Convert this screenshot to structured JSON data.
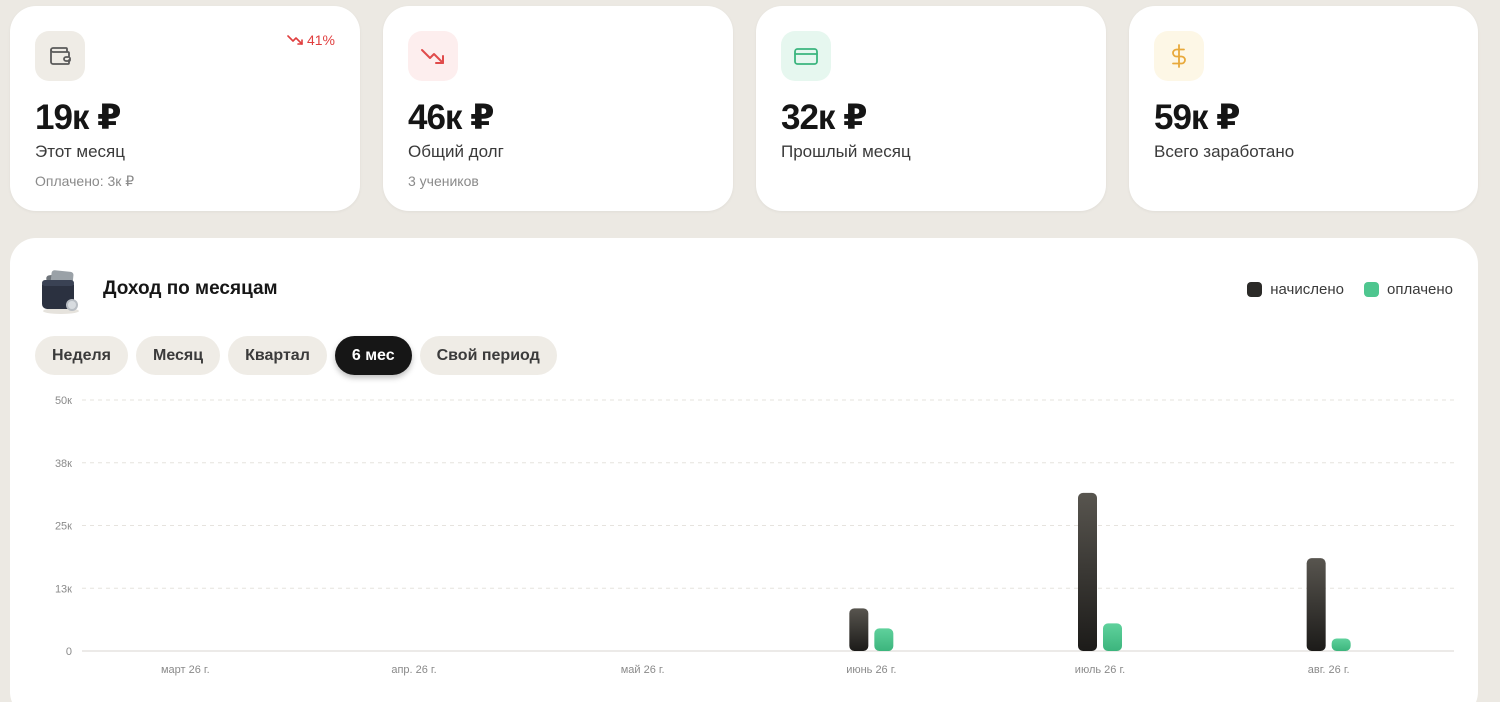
{
  "stats": [
    {
      "icon": "wallet-icon",
      "value": "19к ₽",
      "label": "Этот месяц",
      "sub": "Оплачено: 3к ₽",
      "trend": "41%",
      "icon_bg": "#efece6",
      "icon_color": "#5a5a5a"
    },
    {
      "icon": "trending-down-icon",
      "value": "46к ₽",
      "label": "Общий долг",
      "sub": "3 учеников",
      "icon_bg": "#fdeeee",
      "icon_color": "#e04b4b"
    },
    {
      "icon": "credit-card-icon",
      "value": "32к ₽",
      "label": "Прошлый месяц",
      "icon_bg": "#e6f7ef",
      "icon_color": "#3bb57e"
    },
    {
      "icon": "dollar-icon",
      "value": "59к ₽",
      "label": "Всего заработано",
      "icon_bg": "#fdf7e6",
      "icon_color": "#e8a93b"
    }
  ],
  "income": {
    "title": "Доход по месяцам",
    "icon": "wallet-3d-icon",
    "legend": {
      "charged": "начислено",
      "paid": "оплачено"
    },
    "tabs": [
      "Неделя",
      "Месяц",
      "Квартал",
      "6 мес",
      "Свой период"
    ],
    "active_tab": "6 мес"
  },
  "colors": {
    "charged": "#2b2a28",
    "paid": "#4ec68f",
    "accent_red": "#e03e3e"
  },
  "chart_data": {
    "type": "bar",
    "categories": [
      "март 26 г.",
      "апр. 26 г.",
      "май 26 г.",
      "июнь 26 г.",
      "июль 26 г.",
      "авг. 26 г."
    ],
    "series": [
      {
        "name": "начислено",
        "values": [
          0,
          0,
          0,
          8500,
          31500,
          18500
        ]
      },
      {
        "name": "оплачено",
        "values": [
          0,
          0,
          0,
          4500,
          5500,
          2500
        ]
      }
    ],
    "yticks": [
      0,
      12500,
      25000,
      37500,
      50000
    ],
    "ytick_labels": [
      "0",
      "13к",
      "25к",
      "38к",
      "50к"
    ],
    "ylim": [
      0,
      50000
    ],
    "grid": true,
    "legend": "top-right"
  }
}
